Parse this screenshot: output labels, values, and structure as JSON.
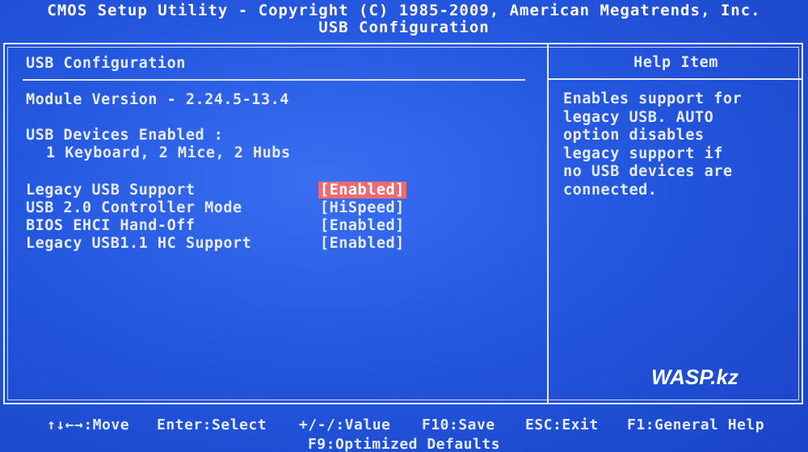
{
  "window": {
    "title": "CMOS Setup Utility - Copyright (C) 1985-2009, American Megatrends, Inc.",
    "subtitle": "USB Configuration"
  },
  "main": {
    "header": "USB Configuration",
    "module_version": "Module Version - 2.24.5-13.4",
    "devices_label": "USB Devices Enabled :",
    "devices_value": "1 Keyboard, 2 Mice, 2 Hubs",
    "options": [
      {
        "label": "Legacy USB Support",
        "value": "[Enabled]",
        "selected": true
      },
      {
        "label": "USB 2.0 Controller Mode",
        "value": "[HiSpeed]",
        "selected": false
      },
      {
        "label": "BIOS EHCI Hand-Off",
        "value": "[Enabled]",
        "selected": false
      },
      {
        "label": "Legacy USB1.1 HC Support",
        "value": "[Enabled]",
        "selected": false
      }
    ]
  },
  "help": {
    "title": "Help Item",
    "lines": [
      "Enables support for",
      "legacy USB. AUTO",
      "option disables",
      "legacy support if",
      "no USB devices are",
      "connected."
    ]
  },
  "footer": {
    "keys": [
      "↑↓←→:Move",
      "Enter:Select",
      "+/-/:Value",
      "F10:Save",
      "ESC:Exit",
      "F1:General Help"
    ],
    "second_line": "F9:Optimized Defaults"
  },
  "watermark": "WASP.kz",
  "colors": {
    "background": "#2457df",
    "text": "#e6ecff",
    "selection": "#f06a72"
  }
}
